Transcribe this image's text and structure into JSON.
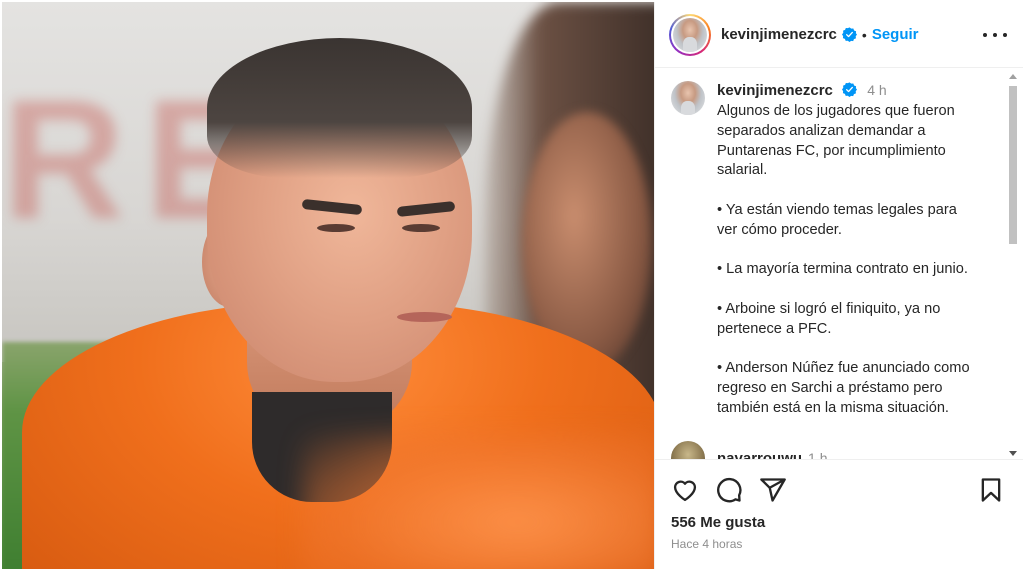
{
  "post": {
    "username": "kevinjimenezcrc",
    "follow_label": "Seguir",
    "separator": "•",
    "caption_time": "4 h",
    "caption_lines": [
      [
        "Algunos de los jugadores que fueron",
        "separados analizan demandar a",
        "Puntarenas FC, por incumplimiento",
        "salarial."
      ],
      [
        "• Ya están viendo temas legales para",
        "ver cómo proceder."
      ],
      [
        "• La mayoría termina contrato en junio."
      ],
      [
        "• Arboine si logró el finiquito, ya no",
        "pertenece a PFC."
      ],
      [
        "• Anderson Núñez fue anunciado como",
        "regreso en Sarchi a préstamo pero",
        "también está en la misma situación."
      ]
    ],
    "comment": {
      "username": "navarrouwu",
      "time": "1 h"
    },
    "likes_label": "556 Me gusta",
    "posted_label": "Hace 4 horas"
  },
  "colors": {
    "accent": "#0095f6",
    "verified": "#0095f6",
    "text": "#262626",
    "secondary": "#8e8e8e"
  },
  "icons": {
    "like": "heart-icon",
    "comment": "comment-icon",
    "share": "share-icon",
    "save": "bookmark-icon",
    "more": "more-options-icon",
    "verified": "verified-badge-icon"
  }
}
